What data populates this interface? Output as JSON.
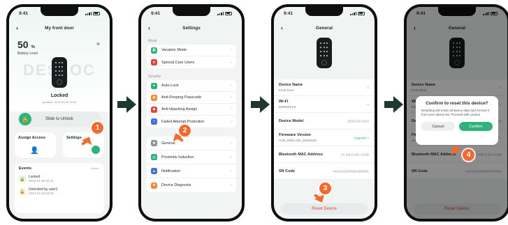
{
  "status": {
    "time": "9:41"
  },
  "brand": "DESLOC",
  "screen1": {
    "title": "My front door",
    "battery_value": "50",
    "battery_unit": "%",
    "battery_label": "Battery Level",
    "lock_state": "Locked",
    "updated": "Updated: 2024-09-20 12:00",
    "slide_label": "Slide to Unlock",
    "tiles": [
      "Assign Access",
      "Settings"
    ],
    "events_title": "Events",
    "events_more": "More >",
    "events": [
      {
        "text": "Locked",
        "time": "2024-12-18 22:22"
      },
      {
        "text": "Unlocked by user1",
        "time": "2024-12-18 22:00"
      }
    ]
  },
  "screen2": {
    "title": "Settings",
    "sections": [
      {
        "label": "Mode",
        "items": [
          {
            "label": "Vacation Mode",
            "icon": "vacation-icon",
            "color": "#2fb37a"
          },
          {
            "label": "Special Care Users",
            "icon": "heart-icon",
            "color": "#e0453a"
          }
        ]
      },
      {
        "label": "Security",
        "items": [
          {
            "label": "Auto-Lock",
            "icon": "lock-icon",
            "color": "#2fb37a"
          },
          {
            "label": "Anti-Peeping Passcode",
            "icon": "eye-icon",
            "color": "#f28a3a"
          },
          {
            "label": "Anti-Hijacking Assign",
            "icon": "shield-icon",
            "color": "#e0453a"
          },
          {
            "label": "Failed Attempt Protection",
            "icon": "alert-icon",
            "color": "#3f74d6"
          }
        ]
      },
      {
        "label": "",
        "items": [
          {
            "label": "General",
            "icon": "gear-icon",
            "color": "#8a9494"
          },
          {
            "label": "Proximity Induction",
            "icon": "proximity-icon",
            "color": "#2fb37a"
          },
          {
            "label": "Notification",
            "icon": "bell-icon",
            "color": "#3f74d6"
          },
          {
            "label": "Device Diagnosis",
            "icon": "diagnosis-icon",
            "color": "#f28a3a"
          }
        ]
      }
    ]
  },
  "screen3": {
    "title": "General",
    "rows": [
      {
        "label": "Device Name",
        "value": "Front Door",
        "right": ">"
      },
      {
        "label": "Wi-Fi",
        "value": "DSMHW-FK",
        "right": ">"
      },
      {
        "label": "Device Model",
        "value": "",
        "right": "DESLOC D212"
      },
      {
        "label": "Firmware Version",
        "value": "AAN_D001.A01_20241120",
        "right": "Upgrade >"
      },
      {
        "label": "Bluetooth MAC Address",
        "value": "",
        "right": "CC:D8:12:B1:A2:9D"
      },
      {
        "label": "SN Code",
        "value": "",
        "right": "AKD21020000001800001"
      }
    ],
    "reset": "Reset Device"
  },
  "screen4": {
    "title": "General",
    "dialog_title": "Confirm to reset this device?",
    "dialog_message": "Resetting will erase all device data and remove it from your device list. Proceed with caution.",
    "cancel": "Cancel",
    "confirm": "Confirm"
  },
  "steps": [
    "1",
    "2",
    "3",
    "4"
  ],
  "colors": {
    "accent": "#2fb37a",
    "step": "#f26a2e",
    "danger": "#e0453a",
    "arrow": "#1e3a30"
  }
}
